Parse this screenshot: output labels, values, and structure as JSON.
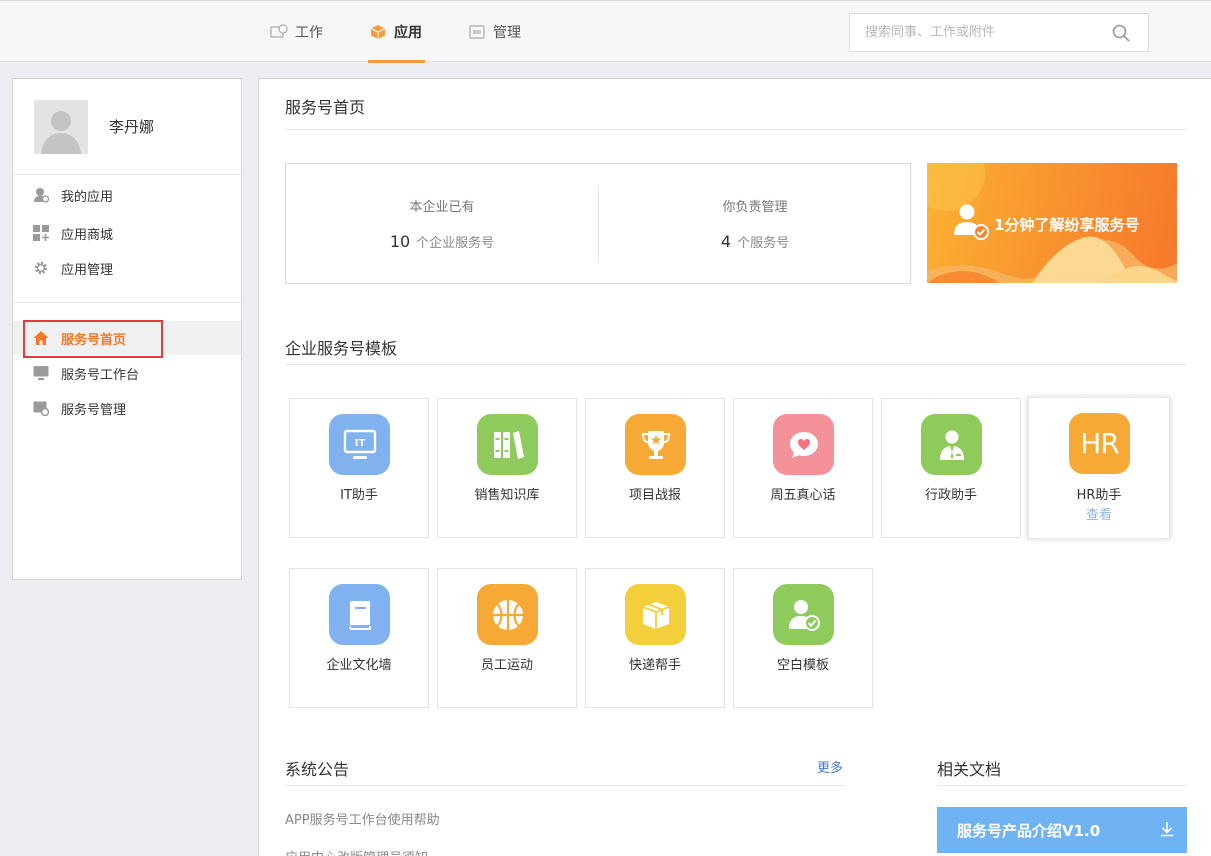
{
  "nav": {
    "tabs": [
      {
        "label": "工作",
        "icon": "work-icon"
      },
      {
        "label": "应用",
        "icon": "cube-icon",
        "active": true
      },
      {
        "label": "管理",
        "icon": "manage-icon"
      }
    ],
    "search_placeholder": "搜索同事、工作或附件"
  },
  "sidebar": {
    "username": "李丹娜",
    "group1": [
      {
        "label": "我的应用",
        "icon": "user-app-icon"
      },
      {
        "label": "应用商城",
        "icon": "app-store-icon"
      },
      {
        "label": "应用管理",
        "icon": "gear-icon"
      }
    ],
    "group2": [
      {
        "label": "服务号首页",
        "icon": "home-icon",
        "active": true
      },
      {
        "label": "服务号工作台",
        "icon": "monitor-icon"
      },
      {
        "label": "服务号管理",
        "icon": "service-manage-icon"
      }
    ]
  },
  "main": {
    "home_title": "服务号首页",
    "stats": [
      {
        "label": "本企业已有",
        "count": "10",
        "unit": "个企业服务号"
      },
      {
        "label": "你负责管理",
        "count": "4",
        "unit": "个服务号"
      }
    ],
    "banner_text": "1分钟了解纷享服务号",
    "templates_title": "企业服务号模板",
    "templates": [
      {
        "name": "IT助手",
        "icon": "it-icon",
        "color": "#7fb2ee"
      },
      {
        "name": "销售知识库",
        "icon": "books-icon",
        "color": "#8fcb5c"
      },
      {
        "name": "项目战报",
        "icon": "trophy-icon",
        "color": "#f6a935"
      },
      {
        "name": "周五真心话",
        "icon": "heart-chat-icon",
        "color": "#f49199"
      },
      {
        "name": "行政助手",
        "icon": "admin-person-icon",
        "color": "#8fcb5c"
      },
      {
        "name": "HR助手",
        "icon": "hr-icon",
        "color": "#f6a935",
        "action": "查看",
        "icon_text": "HR"
      },
      {
        "name": "企业文化墙",
        "icon": "book-icon",
        "color": "#7fb2ee"
      },
      {
        "name": "员工运动",
        "icon": "basketball-icon",
        "color": "#f6a935"
      },
      {
        "name": "快递帮手",
        "icon": "package-icon",
        "color": "#f3cf3c"
      },
      {
        "name": "空白模板",
        "icon": "user-check-icon",
        "color": "#8fcb5c"
      }
    ],
    "notices_title": "系统公告",
    "notices_more": "更多",
    "notices": [
      "APP服务号工作台使用帮助",
      "应用中心改版管理员须知"
    ],
    "docs_title": "相关文档",
    "doc_button": "服务号产品介绍V1.0"
  }
}
